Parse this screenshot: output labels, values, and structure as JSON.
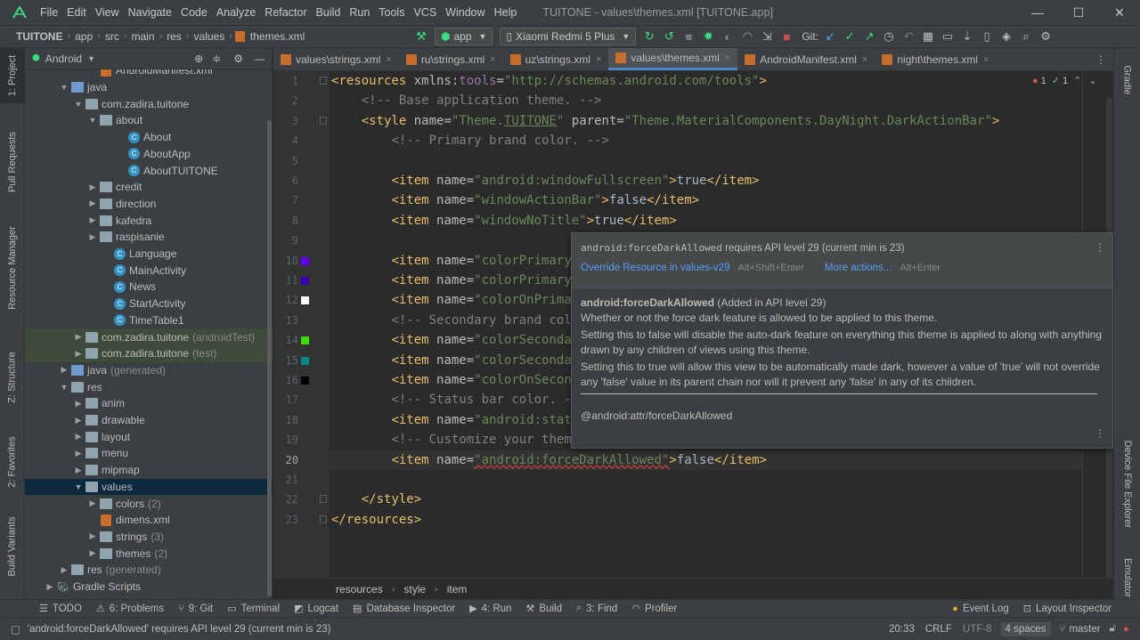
{
  "menu": {
    "items": [
      "File",
      "Edit",
      "View",
      "Navigate",
      "Code",
      "Analyze",
      "Refactor",
      "Build",
      "Run",
      "Tools",
      "VCS",
      "Window",
      "Help"
    ],
    "window_title": "TUITONE - values\\themes.xml [TUITONE.app]"
  },
  "navbar": {
    "crumbs": [
      "TUITONE",
      "app",
      "src",
      "main",
      "res",
      "values",
      "themes.xml"
    ],
    "run_config": "app",
    "device": "Xiaomi Redmi 5 Plus",
    "git_label": "Git:"
  },
  "project_panel": {
    "view_mode": "Android",
    "tree": [
      {
        "label": "AndroidManifest.xml",
        "type": "xml",
        "indent": 4,
        "partial": true
      },
      {
        "label": "java",
        "type": "folder-blue",
        "indent": 2,
        "arrow": "down"
      },
      {
        "label": "com.zadira.tuitone",
        "type": "folder",
        "indent": 3,
        "arrow": "down"
      },
      {
        "label": "about",
        "type": "folder",
        "indent": 4,
        "arrow": "down"
      },
      {
        "label": "About",
        "type": "class",
        "indent": 6
      },
      {
        "label": "AboutApp",
        "type": "class",
        "indent": 6
      },
      {
        "label": "AboutTUITONE",
        "type": "class",
        "indent": 6
      },
      {
        "label": "credit",
        "type": "folder",
        "indent": 4,
        "arrow": "right"
      },
      {
        "label": "direction",
        "type": "folder",
        "indent": 4,
        "arrow": "right"
      },
      {
        "label": "kafedra",
        "type": "folder",
        "indent": 4,
        "arrow": "right"
      },
      {
        "label": "raspisanie",
        "type": "folder",
        "indent": 4,
        "arrow": "right"
      },
      {
        "label": "Language",
        "type": "class",
        "indent": 5
      },
      {
        "label": "MainActivity",
        "type": "class",
        "indent": 5
      },
      {
        "label": "News",
        "type": "class",
        "indent": 5
      },
      {
        "label": "StartActivity",
        "type": "class",
        "indent": 5
      },
      {
        "label": "TimeTable1",
        "type": "class",
        "indent": 5
      },
      {
        "label": "com.zadira.tuitone",
        "suffix": "(androidTest)",
        "type": "folder",
        "indent": 3,
        "arrow": "right",
        "hl": true
      },
      {
        "label": "com.zadira.tuitone",
        "suffix": "(test)",
        "type": "folder",
        "indent": 3,
        "arrow": "right",
        "hl": true
      },
      {
        "label": "java",
        "suffix": "(generated)",
        "type": "folder-blue",
        "indent": 2,
        "arrow": "right"
      },
      {
        "label": "res",
        "type": "folder",
        "indent": 2,
        "arrow": "down"
      },
      {
        "label": "anim",
        "type": "folder",
        "indent": 3,
        "arrow": "right"
      },
      {
        "label": "drawable",
        "type": "folder",
        "indent": 3,
        "arrow": "right"
      },
      {
        "label": "layout",
        "type": "folder",
        "indent": 3,
        "arrow": "right"
      },
      {
        "label": "menu",
        "type": "folder",
        "indent": 3,
        "arrow": "right"
      },
      {
        "label": "mipmap",
        "type": "folder",
        "indent": 3,
        "arrow": "right"
      },
      {
        "label": "values",
        "type": "folder",
        "indent": 3,
        "arrow": "down",
        "sel": true
      },
      {
        "label": "colors",
        "suffix": "(2)",
        "type": "folder",
        "indent": 4,
        "arrow": "right"
      },
      {
        "label": "dimens.xml",
        "type": "xml",
        "indent": 4
      },
      {
        "label": "strings",
        "suffix": "(3)",
        "type": "folder",
        "indent": 4,
        "arrow": "right"
      },
      {
        "label": "themes",
        "suffix": "(2)",
        "type": "folder",
        "indent": 4,
        "arrow": "right"
      },
      {
        "label": "res",
        "suffix": "(generated)",
        "type": "folder",
        "indent": 2,
        "arrow": "right"
      },
      {
        "label": "Gradle Scripts",
        "type": "gradle",
        "indent": 1,
        "arrow": "right"
      }
    ]
  },
  "left_tabs": [
    "1: Project",
    "Pull Requests",
    "Resource Manager",
    "Z: Structure",
    "2: Favorites",
    "Build Variants"
  ],
  "right_tabs": [
    "Gradle",
    "Device File Explorer",
    "Emulator"
  ],
  "editor_tabs": [
    {
      "label": "values\\strings.xml",
      "active": false
    },
    {
      "label": "ru\\strings.xml",
      "active": false
    },
    {
      "label": "uz\\strings.xml",
      "active": false
    },
    {
      "label": "values\\themes.xml",
      "active": true
    },
    {
      "label": "AndroidManifest.xml",
      "active": false
    },
    {
      "label": "night\\themes.xml",
      "active": false
    }
  ],
  "inspections": {
    "errors": "1",
    "ok": "1"
  },
  "code_lines": [
    {
      "n": "1",
      "html": "<span class='tag'>&lt;resources </span><span class='an'>xmlns:</span><span class='ns'>tools</span><span class='an'>=</span><span class='av'>\"http://schemas.android.com/tools\"</span><span class='tag'>&gt;</span>"
    },
    {
      "n": "2",
      "html": "    <span class='cm'>&lt;!-- Base application theme. --&gt;</span>"
    },
    {
      "n": "3",
      "html": "    <span class='tag'>&lt;style </span><span class='an'>name=</span><span class='av'>\"Theme.<u>TUITONE</u>\"</span> <span class='an'>parent=</span><span class='av'>\"Theme.MaterialComponents.DayNight.DarkActionBar\"</span><span class='tag'>&gt;</span>"
    },
    {
      "n": "4",
      "html": "        <span class='cm'>&lt;!-- Primary brand color. --&gt;</span>"
    },
    {
      "n": "5",
      "html": ""
    },
    {
      "n": "6",
      "html": "        <span class='tag'>&lt;item </span><span class='an'>name=</span><span class='av'>\"android:windowFullscreen\"</span><span class='tag'>&gt;</span>true<span class='tag'>&lt;/item&gt;</span>"
    },
    {
      "n": "7",
      "html": "        <span class='tag'>&lt;item </span><span class='an'>name=</span><span class='av'>\"windowActionBar\"</span><span class='tag'>&gt;</span>false<span class='tag'>&lt;/item&gt;</span>"
    },
    {
      "n": "8",
      "html": "        <span class='tag'>&lt;item </span><span class='an'>name=</span><span class='av'>\"windowNoTitle\"</span><span class='tag'>&gt;</span>true<span class='tag'>&lt;/item&gt;</span>"
    },
    {
      "n": "9",
      "html": ""
    },
    {
      "n": "10",
      "html": "        <span class='tag'>&lt;item </span><span class='an'>name=</span><span class='av'>\"colorPrimary</span>"
    },
    {
      "n": "11",
      "html": "        <span class='tag'>&lt;item </span><span class='an'>name=</span><span class='av'>\"colorPrimary</span>"
    },
    {
      "n": "12",
      "html": "        <span class='tag'>&lt;item </span><span class='an'>name=</span><span class='av'>\"colorOnPrima</span>"
    },
    {
      "n": "13",
      "html": "        <span class='cm'>&lt;!-- Secondary brand col</span>"
    },
    {
      "n": "14",
      "html": "        <span class='tag'>&lt;item </span><span class='an'>name=</span><span class='av'>\"colorSeconda</span>"
    },
    {
      "n": "15",
      "html": "        <span class='tag'>&lt;item </span><span class='an'>name=</span><span class='av'>\"colorSeconda</span>"
    },
    {
      "n": "16",
      "html": "        <span class='tag'>&lt;item </span><span class='an'>name=</span><span class='av'>\"colorOnSecon</span>"
    },
    {
      "n": "17",
      "html": "        <span class='cm'>&lt;!-- Status bar color. -</span>"
    },
    {
      "n": "18",
      "html": "        <span class='tag'>&lt;item </span><span class='an'>name=</span><span class='av'>\"android:stat</span>"
    },
    {
      "n": "19",
      "html": "        <span class='cm'>&lt;!-- Customize your them</span>"
    },
    {
      "n": "20",
      "html": "        <span class='tag'>&lt;item </span><span class='an'>name=</span><span class='av err'>\"android:forceDarkAllowed\"</span><span class='tag'>&gt;</span>false<span class='tag'>&lt;/item&gt;</span>"
    },
    {
      "n": "21",
      "html": ""
    },
    {
      "n": "22",
      "html": "    <span class='tag'>&lt;/style&gt;</span>"
    },
    {
      "n": "23",
      "html": "<span class='tag'>&lt;/resources&gt;</span>"
    }
  ],
  "swatches": [
    {
      "line": "10",
      "color": "#6200ee"
    },
    {
      "line": "11",
      "color": "#3700b3"
    },
    {
      "line": "12",
      "color": "#ffffff"
    },
    {
      "line": "14",
      "color": "#3ddc00"
    },
    {
      "line": "15",
      "color": "#018786"
    },
    {
      "line": "16",
      "color": "#000000"
    }
  ],
  "current_line": "20",
  "popup": {
    "warning_code": "android:forceDarkAllowed",
    "warning_rest": " requires API level 29 (current min is 23)",
    "fix_label": "Override Resource in values-v29",
    "fix_shortcut": "Alt+Shift+Enter",
    "more_label": "More actions...",
    "more_shortcut": "Alt+Enter",
    "doc_title": "android:forceDarkAllowed",
    "doc_added": " (Added in API level 29)",
    "doc_p1": "Whether or not the force dark feature is allowed to be applied to this theme.",
    "doc_p2": "Setting this to false will disable the auto-dark feature on everything this theme is applied to along with anything drawn by any children of views using this theme.",
    "doc_p3": "Setting this to true will allow this view to be automatically made dark, however a value of 'true' will not override any 'false' value in its parent chain nor will it prevent any 'false' in any of its children.",
    "doc_ref": "@android:attr/forceDarkAllowed"
  },
  "editor_breadcrumb": [
    "resources",
    "style",
    "item"
  ],
  "bottom_tabs": [
    {
      "label": "TODO",
      "icon": "☰"
    },
    {
      "label": "6: Problems",
      "icon": "⚠"
    },
    {
      "label": "9: Git",
      "icon": "⑂"
    },
    {
      "label": "Terminal",
      "icon": "▭"
    },
    {
      "label": "Logcat",
      "icon": "◩"
    },
    {
      "label": "Database Inspector",
      "icon": "▤"
    },
    {
      "label": "4: Run",
      "icon": "▶"
    },
    {
      "label": "Build",
      "icon": "⚒"
    },
    {
      "label": "3: Find",
      "icon": "⌕"
    },
    {
      "label": "Profiler",
      "icon": "◠"
    }
  ],
  "bottom_right_tabs": [
    {
      "label": "Event Log",
      "icon": "●"
    },
    {
      "label": "Layout Inspector",
      "icon": "⊡"
    }
  ],
  "status": {
    "message": "'android:forceDarkAllowed' requires API level 29 (current min is 23)",
    "position": "20:33",
    "line_sep": "CRLF",
    "encoding": "UTF-8",
    "indent": "4 spaces",
    "branch": "master"
  },
  "colors": {
    "accent": "#4a88c7",
    "error": "#bc3f3c",
    "link": "#589df6"
  }
}
